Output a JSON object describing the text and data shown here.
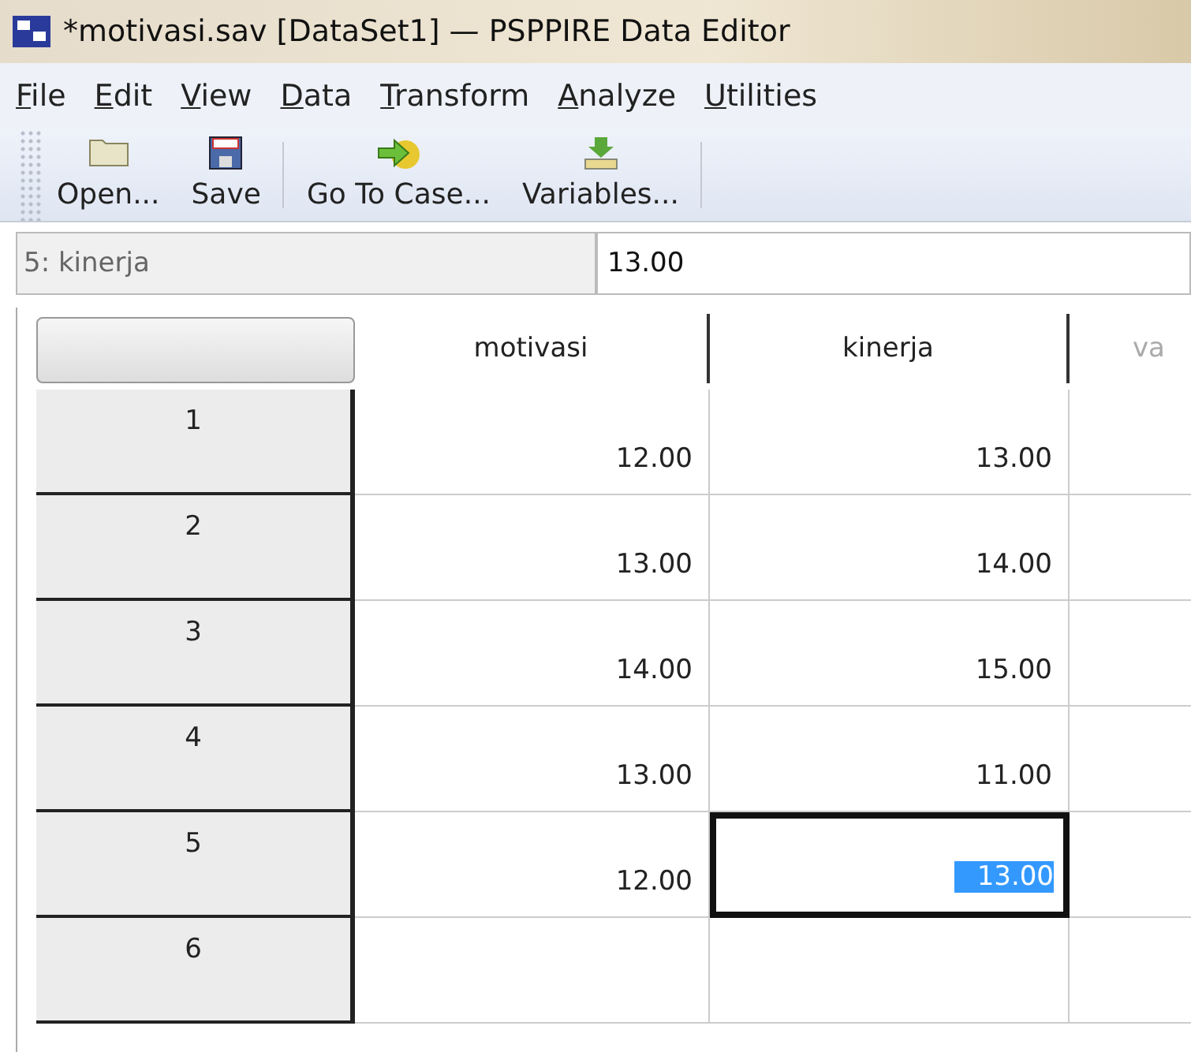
{
  "window": {
    "title": "*motivasi.sav [DataSet1] — PSPPIRE Data Editor"
  },
  "menu": [
    {
      "label": "File"
    },
    {
      "label": "Edit"
    },
    {
      "label": "View"
    },
    {
      "label": "Data"
    },
    {
      "label": "Transform"
    },
    {
      "label": "Analyze"
    },
    {
      "label": "Utilities"
    }
  ],
  "toolbar": [
    {
      "kind": "open",
      "label": "Open..."
    },
    {
      "kind": "save",
      "label": "Save"
    },
    {
      "kind": "goto",
      "label": "Go To Case..."
    },
    {
      "kind": "variables",
      "label": "Variables..."
    }
  ],
  "cell_ref": {
    "name": "5: kinerja",
    "value": "13.00"
  },
  "table": {
    "columns": [
      "motivasi",
      "kinerja",
      "va"
    ],
    "rows": [
      {
        "label": "1",
        "cells": [
          {
            "value": "12.00",
            "selected": false
          },
          {
            "value": "13.00",
            "selected": false
          }
        ]
      },
      {
        "label": "2",
        "cells": [
          {
            "value": "13.00",
            "selected": false
          },
          {
            "value": "14.00",
            "selected": false
          }
        ]
      },
      {
        "label": "3",
        "cells": [
          {
            "value": "14.00",
            "selected": false
          },
          {
            "value": "15.00",
            "selected": false
          }
        ]
      },
      {
        "label": "4",
        "cells": [
          {
            "value": "13.00",
            "selected": false
          },
          {
            "value": "11.00",
            "selected": false
          }
        ]
      },
      {
        "label": "5",
        "cells": [
          {
            "value": "12.00",
            "selected": false
          },
          {
            "value": "13.00",
            "selected": true
          }
        ]
      },
      {
        "label": "6",
        "cells": []
      }
    ]
  }
}
